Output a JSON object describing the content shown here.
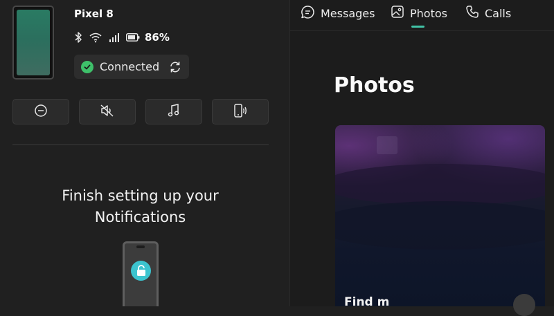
{
  "device": {
    "name": "Pixel 8",
    "battery_percent": "86%",
    "status_icons": [
      "bluetooth-icon",
      "wifi-icon",
      "cellular-signal-icon",
      "battery-icon"
    ],
    "connection": {
      "label": "Connected",
      "status_color": "#3ec06a"
    }
  },
  "quick_actions": [
    {
      "icon": "do-not-disturb-icon"
    },
    {
      "icon": "mute-icon"
    },
    {
      "icon": "music-note-icon"
    },
    {
      "icon": "phone-ring-icon"
    }
  ],
  "setup": {
    "title_line1": "Finish setting up your",
    "title_line2": "Notifications",
    "illustration_icon": "lock-icon",
    "accent_color": "#3cc4cf"
  },
  "tabs": [
    {
      "label": "Messages",
      "icon": "chat-bubble-icon",
      "selected": false
    },
    {
      "label": "Photos",
      "icon": "photo-icon",
      "selected": true
    },
    {
      "label": "Calls",
      "icon": "phone-icon",
      "selected": false
    }
  ],
  "tab_accent_color": "#42c3a6",
  "main": {
    "title": "Photos",
    "card_label": "Find m"
  }
}
